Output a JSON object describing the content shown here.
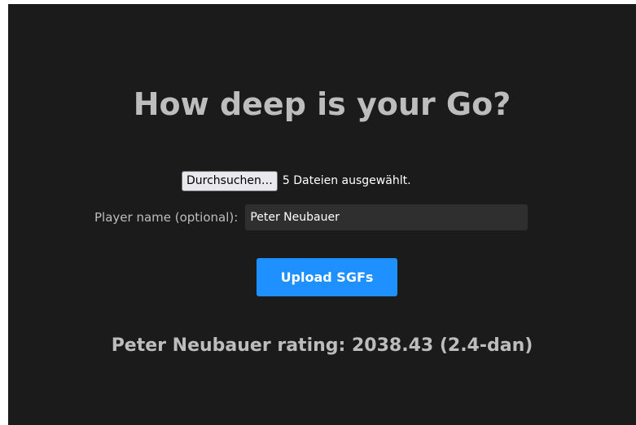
{
  "page": {
    "title": "How deep is your Go?"
  },
  "upload_form": {
    "browse_label": "Durchsuchen…",
    "file_status": "5 Dateien ausgewählt.",
    "player_label": "Player name (optional):",
    "player_value": "Peter Neubauer",
    "submit_label": "Upload SGFs"
  },
  "result": {
    "text": "Peter Neubauer rating: 2038.43 (2.4-dan)"
  },
  "colors": {
    "background": "#1c1b1c",
    "text": "#bdbdbd",
    "accent": "#1e90ff"
  }
}
